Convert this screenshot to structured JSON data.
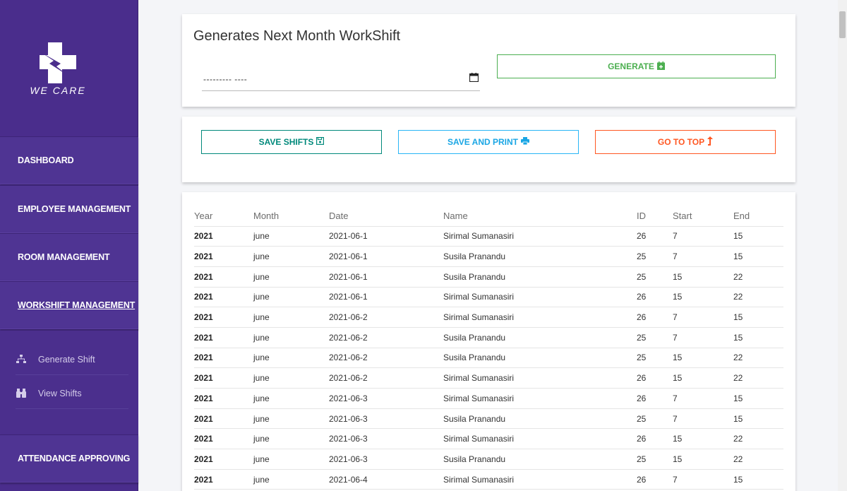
{
  "brand": {
    "logo_text": "WE CARE"
  },
  "sidebar": {
    "items": [
      {
        "label": "DASHBOARD"
      },
      {
        "label": "EMPLOYEE MANAGEMENT"
      },
      {
        "label": "ROOM MANAGEMENT"
      },
      {
        "label": "WORKSHIFT MANAGEMENT",
        "active": true
      },
      {
        "label": "ATTENDANCE APPROVING"
      }
    ],
    "subitems": [
      {
        "label": "Generate Shift",
        "icon": "sitemap-icon"
      },
      {
        "label": "View Shifts",
        "icon": "binoculars-icon"
      }
    ]
  },
  "generate_card": {
    "title": "Generates Next Month WorkShift",
    "date_value": "--------- ----",
    "generate_label": "GENERATE"
  },
  "actions": {
    "save_label": "SAVE SHIFTS",
    "save_print_label": "SAVE AND PRINT",
    "top_label": "GO TO TOP"
  },
  "table": {
    "columns": [
      "Year",
      "Month",
      "Date",
      "Name",
      "ID",
      "Start",
      "End"
    ],
    "rows": [
      [
        "2021",
        "june",
        "2021-06-1",
        "Sirimal Sumanasiri",
        "26",
        "7",
        "15"
      ],
      [
        "2021",
        "june",
        "2021-06-1",
        "Susila Pranandu",
        "25",
        "7",
        "15"
      ],
      [
        "2021",
        "june",
        "2021-06-1",
        "Susila Pranandu",
        "25",
        "15",
        "22"
      ],
      [
        "2021",
        "june",
        "2021-06-1",
        "Sirimal Sumanasiri",
        "26",
        "15",
        "22"
      ],
      [
        "2021",
        "june",
        "2021-06-2",
        "Sirimal Sumanasiri",
        "26",
        "7",
        "15"
      ],
      [
        "2021",
        "june",
        "2021-06-2",
        "Susila Pranandu",
        "25",
        "7",
        "15"
      ],
      [
        "2021",
        "june",
        "2021-06-2",
        "Susila Pranandu",
        "25",
        "15",
        "22"
      ],
      [
        "2021",
        "june",
        "2021-06-2",
        "Sirimal Sumanasiri",
        "26",
        "15",
        "22"
      ],
      [
        "2021",
        "june",
        "2021-06-3",
        "Sirimal Sumanasiri",
        "26",
        "7",
        "15"
      ],
      [
        "2021",
        "june",
        "2021-06-3",
        "Susila Pranandu",
        "25",
        "7",
        "15"
      ],
      [
        "2021",
        "june",
        "2021-06-3",
        "Sirimal Sumanasiri",
        "26",
        "15",
        "22"
      ],
      [
        "2021",
        "june",
        "2021-06-3",
        "Susila Pranandu",
        "25",
        "15",
        "22"
      ],
      [
        "2021",
        "june",
        "2021-06-4",
        "Sirimal Sumanasiri",
        "26",
        "7",
        "15"
      ]
    ]
  },
  "colors": {
    "sidebar": "#4a2d8c",
    "generate": "#4caf50",
    "save": "#00897b",
    "save_print": "#29b6f6",
    "top": "#ff5722"
  }
}
